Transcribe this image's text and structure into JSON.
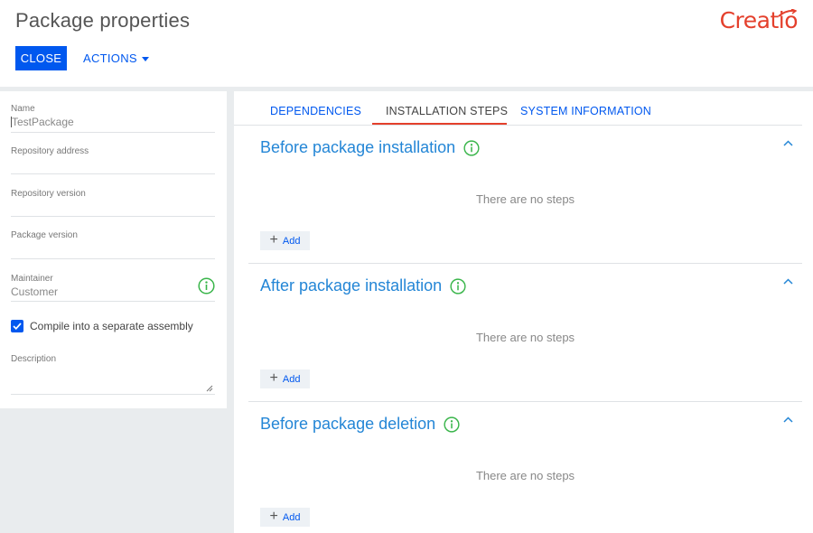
{
  "header": {
    "title": "Package properties",
    "logo_text": "Creatio",
    "close_label": "CLOSE",
    "actions_label": "ACTIONS"
  },
  "colors": {
    "primary": "#0058ef",
    "brand": "#e4402c",
    "section_title": "#2486d6",
    "info_green": "#39b54a"
  },
  "left": {
    "name": {
      "label": "Name",
      "value": "TestPackage"
    },
    "repo_address": {
      "label": "Repository address",
      "value": ""
    },
    "repo_version": {
      "label": "Repository version",
      "value": ""
    },
    "package_version": {
      "label": "Package version",
      "value": ""
    },
    "maintainer": {
      "label": "Maintainer",
      "value": "Customer"
    },
    "compile_label": "Compile into a separate assembly",
    "compile_checked": true,
    "description": {
      "label": "Description",
      "value": ""
    }
  },
  "tabs": [
    {
      "label": "DEPENDENCIES",
      "active": false
    },
    {
      "label": "INSTALLATION STEPS",
      "active": true
    },
    {
      "label": "SYSTEM INFORMATION",
      "active": false
    }
  ],
  "sections": [
    {
      "title": "Before package installation",
      "empty_text": "There are no steps",
      "add_label": "Add"
    },
    {
      "title": "After package installation",
      "empty_text": "There are no steps",
      "add_label": "Add"
    },
    {
      "title": "Before package deletion",
      "empty_text": "There are no steps",
      "add_label": "Add"
    }
  ],
  "icons": [
    "info-icon",
    "chevron-up-icon",
    "plus-icon",
    "checkmark-icon",
    "resize-handle-icon",
    "caret-down-icon"
  ]
}
